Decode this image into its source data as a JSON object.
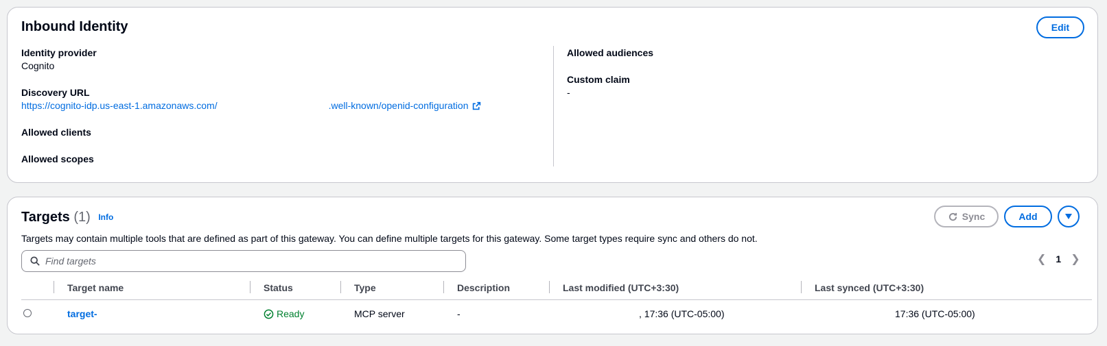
{
  "identity": {
    "title": "Inbound Identity",
    "edit_label": "Edit",
    "provider_label": "Identity provider",
    "provider_value": "Cognito",
    "discovery_label": "Discovery URL",
    "discovery_prefix": "https://cognito-idp.us-east-1.amazonaws.com/",
    "discovery_suffix": ".well-known/openid-configuration",
    "clients_label": "Allowed clients",
    "scopes_label": "Allowed scopes",
    "audiences_label": "Allowed audiences",
    "claim_label": "Custom claim",
    "claim_value": "-"
  },
  "targets": {
    "title": "Targets",
    "count": "(1)",
    "info_label": "Info",
    "description": "Targets may contain multiple tools that are defined as part of this gateway. You can define multiple targets for this gateway. Some target types require sync and others do not.",
    "sync_label": "Sync",
    "add_label": "Add",
    "search_placeholder": "Find targets",
    "page_number": "1",
    "columns": [
      "Target name",
      "Status",
      "Type",
      "Description",
      "Last modified (UTC+3:30)",
      "Last synced (UTC+3:30)"
    ],
    "rows": [
      {
        "name": "target-",
        "status": "Ready",
        "type": "MCP server",
        "description": "-",
        "last_modified": ", 17:36 (UTC-05:00)",
        "last_synced": "17:36 (UTC-05:00)"
      }
    ]
  },
  "colors": {
    "link": "#006ce0",
    "success": "#00802f",
    "border": "#c6c6cd"
  }
}
